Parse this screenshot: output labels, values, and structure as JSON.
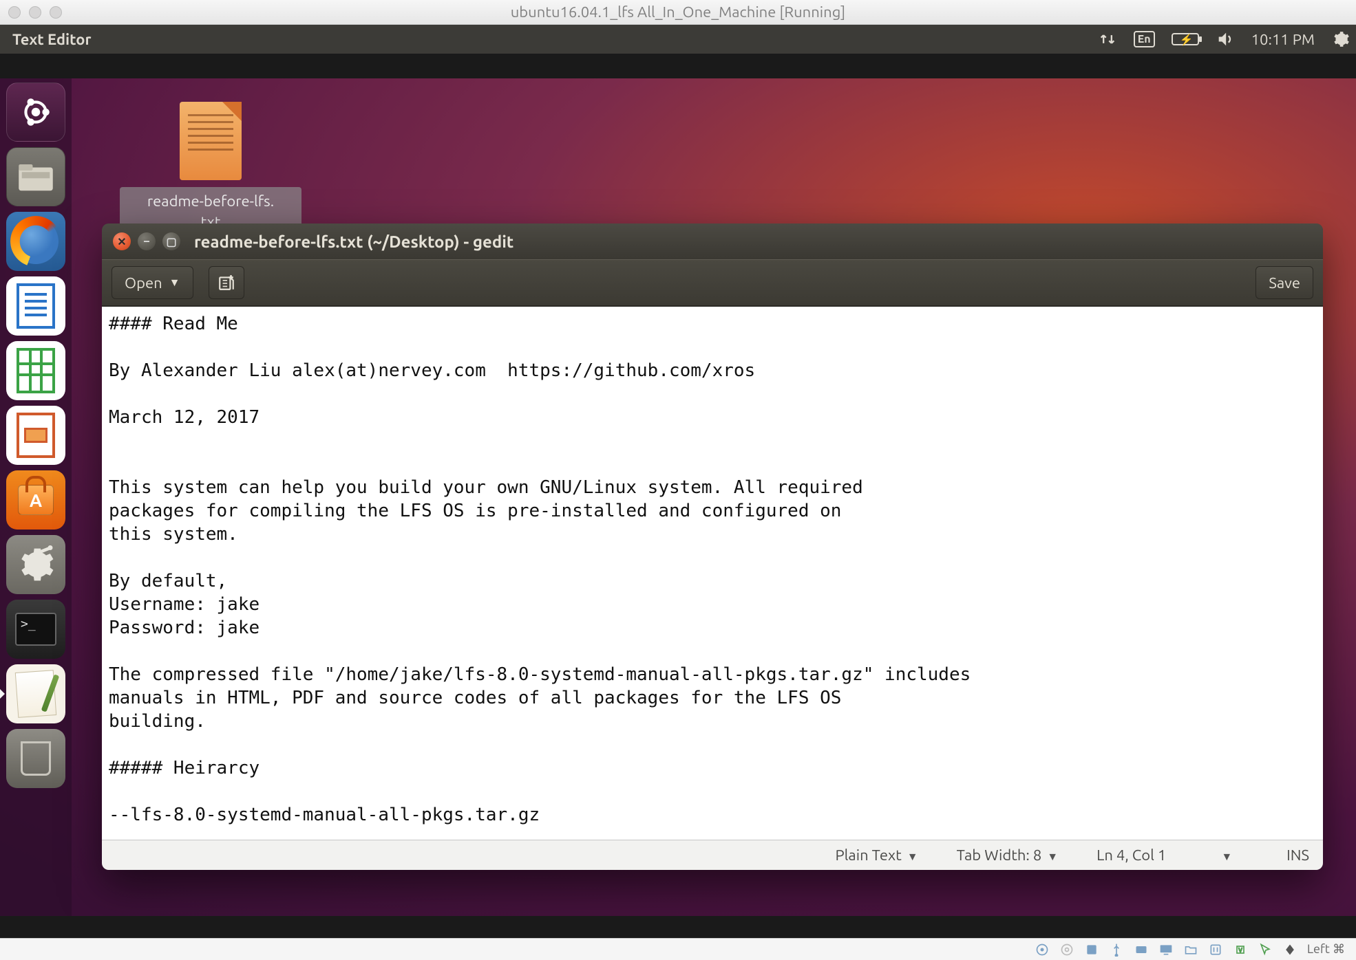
{
  "host": {
    "title": "ubuntu16.04.1_lfs All_In_One_Machine [Running]",
    "status_right": "Left ⌘"
  },
  "topbar": {
    "app_title": "Text Editor",
    "lang": "En",
    "clock": "10:11 PM"
  },
  "desktop_file": {
    "label": "readme-before-lfs.\ntxt"
  },
  "gedit": {
    "title": "readme-before-lfs.txt (~/Desktop) - gedit",
    "open_label": "Open",
    "save_label": "Save",
    "body": "#### Read Me\n\nBy Alexander Liu alex(at)nervey.com  https://github.com/xros\n\nMarch 12, 2017\n\n\nThis system can help you build your own GNU/Linux system. All required\npackages for compiling the LFS OS is pre-installed and configured on\nthis system.\n\nBy default,\nUsername: jake\nPassword: jake\n\nThe compressed file \"/home/jake/lfs-8.0-systemd-manual-all-pkgs.tar.gz\" includes\nmanuals in HTML, PDF and source codes of all packages for the LFS OS\nbuilding.\n\n##### Heirarcy\n\n--lfs-8.0-systemd-manual-all-pkgs.tar.gz",
    "status": {
      "lang_mode": "Plain Text",
      "tab_width": "Tab Width: 8",
      "cursor": "Ln 4, Col 1",
      "ins": "INS"
    }
  },
  "launcher": {
    "items": [
      "dash",
      "files",
      "firefox",
      "writer",
      "calc",
      "impress",
      "software",
      "settings",
      "terminal",
      "gedit",
      "trash"
    ]
  }
}
